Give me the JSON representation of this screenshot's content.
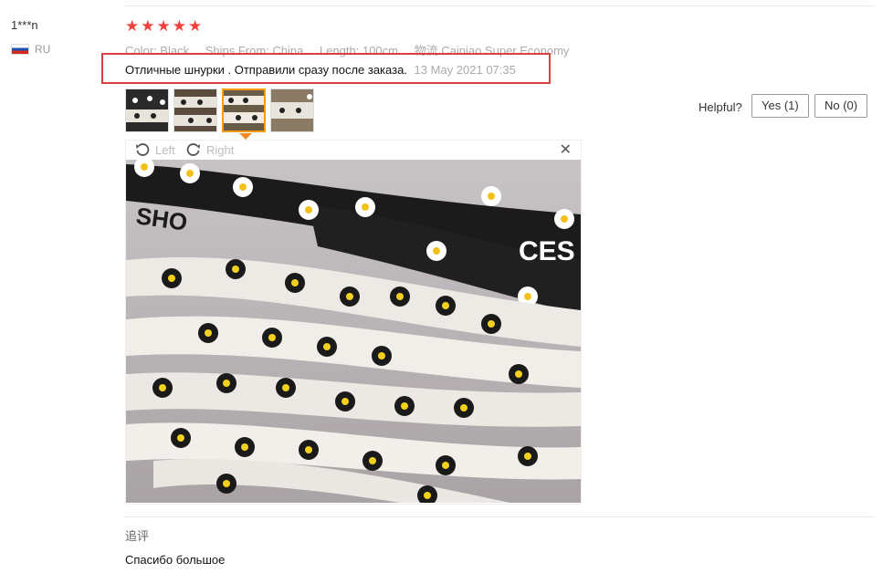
{
  "user": {
    "name": "1***n",
    "country": "RU"
  },
  "rating": {
    "stars": 5
  },
  "attributes": {
    "color": "Color: Black",
    "ships_from": "Ships From: China",
    "length": "Length: 100cm",
    "logistics": "物流 Cainiao Super Economy"
  },
  "review": {
    "text": "Отличные шнурки . Отправили сразу после заказа.",
    "date": "13 May 2021 07:35"
  },
  "helpful": {
    "label": "Helpful?",
    "yes": "Yes (1)",
    "no": "No (0)"
  },
  "viewer": {
    "left": "Left",
    "right": "Right",
    "close": "✕"
  },
  "followup": {
    "label": "追评",
    "text": "Спасибо большое"
  },
  "colors": {
    "star": "#f0413c",
    "highlight": "#d94040",
    "active_thumb": "#f39c12"
  }
}
